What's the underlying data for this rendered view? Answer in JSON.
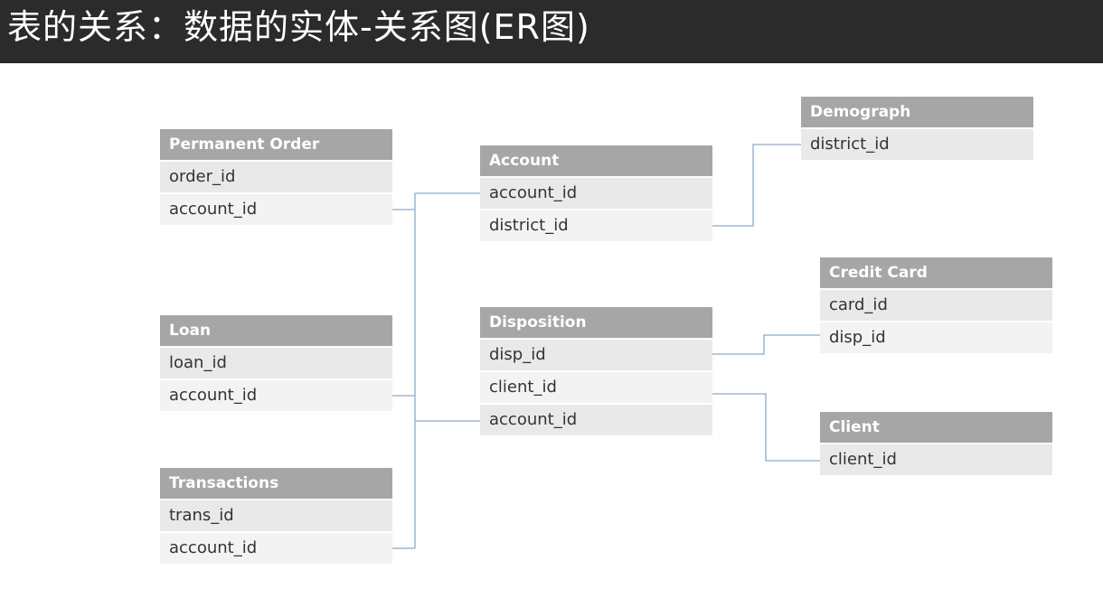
{
  "title": "表的关系：数据的实体-关系图(ER图)",
  "entities": {
    "permanent_order": {
      "name": "Permanent Order",
      "fields": [
        "order_id",
        "account_id"
      ]
    },
    "loan": {
      "name": "Loan",
      "fields": [
        "loan_id",
        "account_id"
      ]
    },
    "transactions": {
      "name": "Transactions",
      "fields": [
        "trans_id",
        "account_id"
      ]
    },
    "account": {
      "name": "Account",
      "fields": [
        "account_id",
        "district_id"
      ]
    },
    "disposition": {
      "name": "Disposition",
      "fields": [
        "disp_id",
        "client_id",
        "account_id"
      ]
    },
    "demograph": {
      "name": "Demograph",
      "fields": [
        "district_id"
      ]
    },
    "credit_card": {
      "name": "Credit Card",
      "fields": [
        "card_id",
        "disp_id"
      ]
    },
    "client": {
      "name": "Client",
      "fields": [
        "client_id"
      ]
    }
  },
  "colors": {
    "title_bar": "#2b2b2b",
    "header": "#a6a6a6",
    "field": "#e9e9e9",
    "connector": "#8ea9c8"
  }
}
